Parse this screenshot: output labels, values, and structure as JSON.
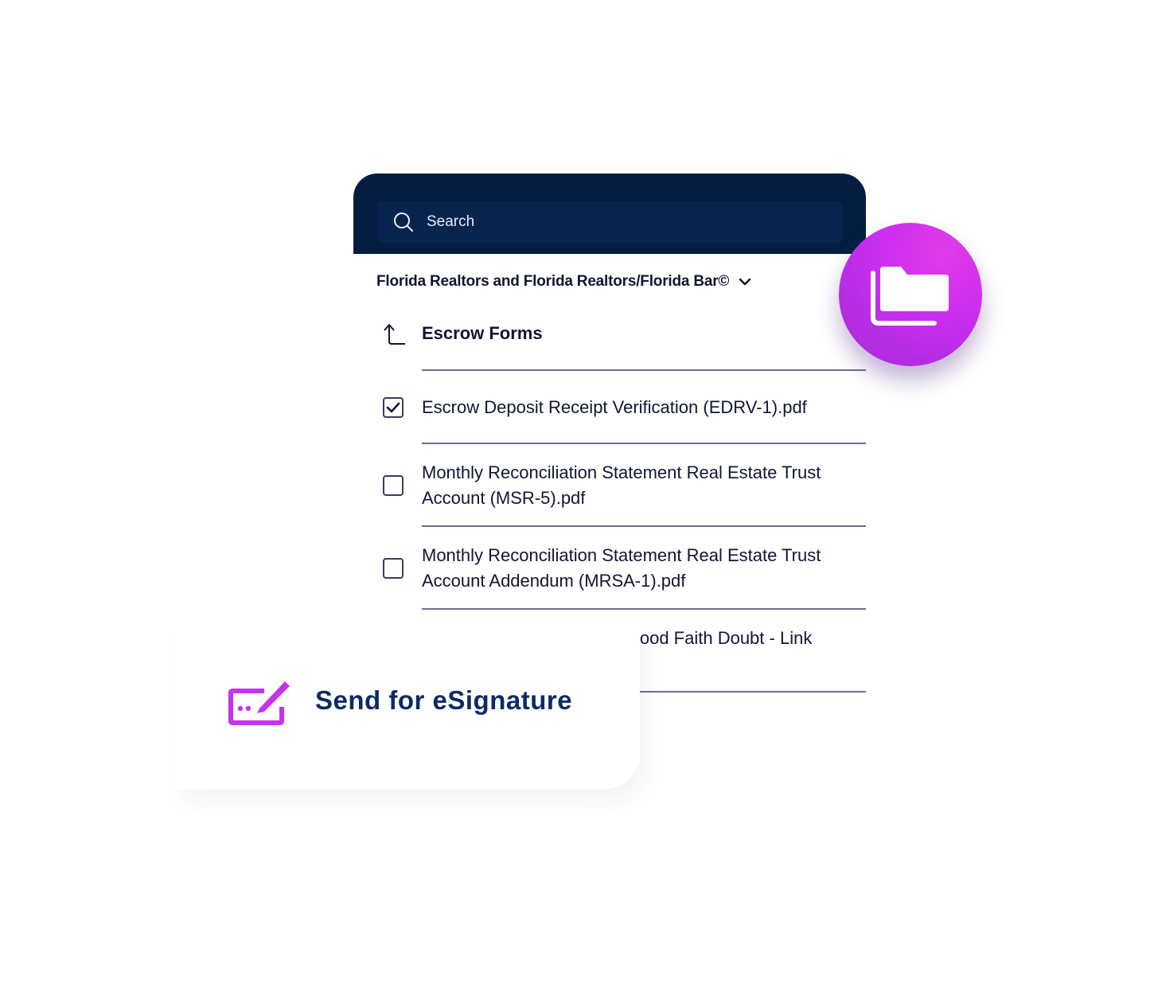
{
  "search": {
    "placeholder": "Search",
    "icon": "search-icon"
  },
  "library": {
    "name": "Florida Realtors and Florida Realtors/Florida Bar©",
    "icon": "chevron-down-icon"
  },
  "folder": {
    "name": "Escrow Forms",
    "icon": "arrow-up-left-icon"
  },
  "files": [
    {
      "name": "Escrow Deposit Receipt Verification (EDRV-1).pdf",
      "checked": true
    },
    {
      "name": "Monthly Reconciliation Statement Real Estate Trust Account (MSR-5).pdf",
      "checked": false
    },
    {
      "name": "Monthly Reconciliation Statement Real Estate Trust Account Addendum (MRSA-1).pdf",
      "checked": false
    },
    {
      "name": "Notice Of Escrow Dispute Good Faith Doubt - Link .pdf",
      "checked": false
    }
  ],
  "esign": {
    "label": "Send for eSignature",
    "icon": "signature-icon"
  },
  "badge": {
    "icon": "folder-icon"
  },
  "colors": {
    "header": "#041e42",
    "accent": "#c632ee",
    "text": "#101633",
    "esign_text": "#0c2b63"
  }
}
